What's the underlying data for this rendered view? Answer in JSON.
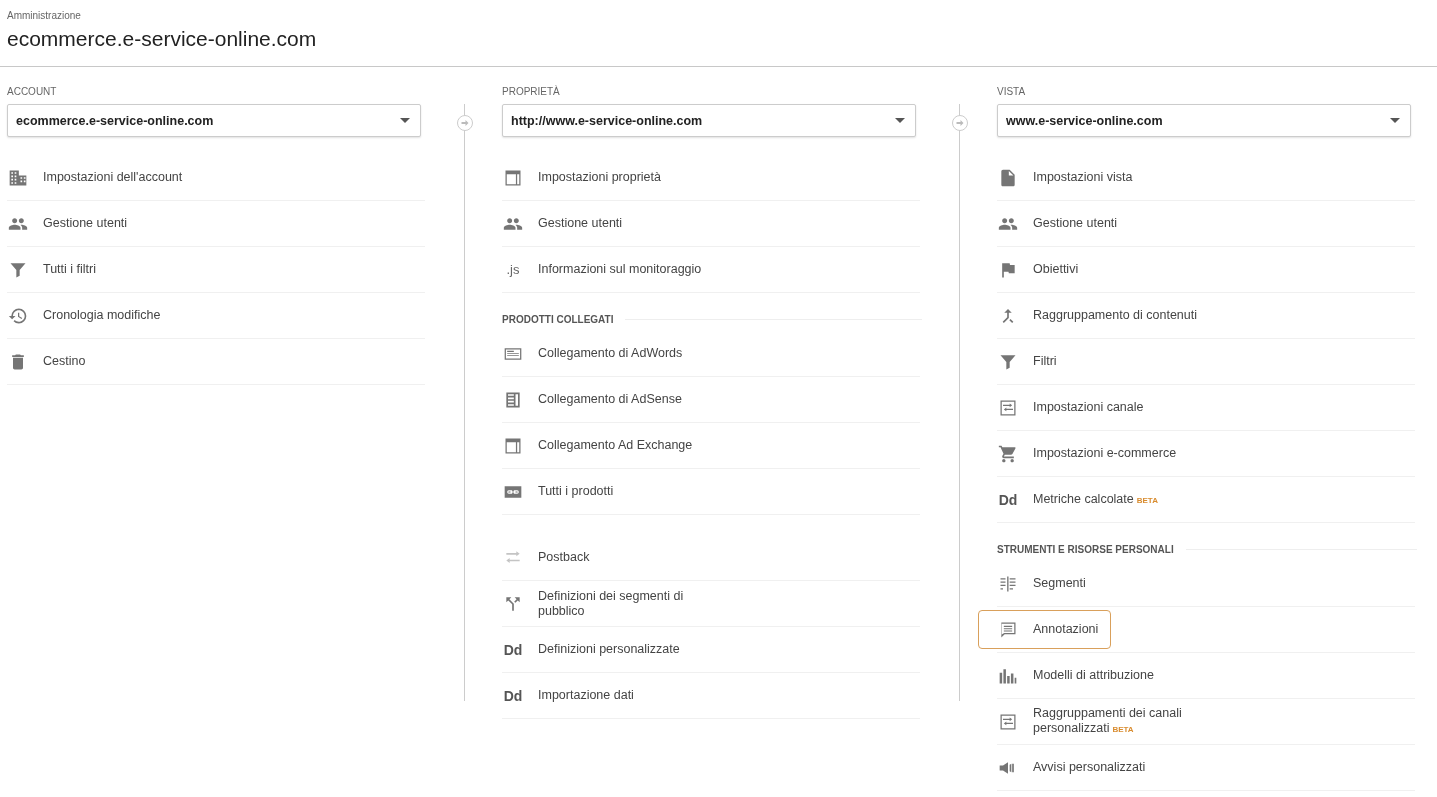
{
  "header": {
    "breadcrumb": "Amministrazione",
    "title": "ecommerce.e-service-online.com"
  },
  "columns": [
    {
      "label": "ACCOUNT",
      "dropdown": {
        "value": "ecommerce.e-service-online.com"
      },
      "sections": [
        {
          "items": [
            {
              "kind": "building",
              "label": "Impostazioni dell'account",
              "selected": false
            },
            {
              "kind": "people",
              "label": "Gestione utenti",
              "selected": false
            },
            {
              "kind": "filter",
              "label": "Tutti i filtri",
              "selected": false
            },
            {
              "kind": "history",
              "label": "Cronologia modifiche",
              "selected": false
            },
            {
              "kind": "trash",
              "label": "Cestino",
              "selected": false
            }
          ]
        }
      ]
    },
    {
      "label": "PROPRIETÀ",
      "dropdown": {
        "value": "http://www.e-service-online.com"
      },
      "sections": [
        {
          "items": [
            {
              "kind": "window",
              "label": "Impostazioni proprietà",
              "selected": false
            },
            {
              "kind": "people",
              "label": "Gestione utenti",
              "selected": false
            },
            {
              "kind": "glyph",
              "icon_text": ".js",
              "label": "Informazioni sul monitoraggio",
              "selected": false
            }
          ]
        },
        {
          "heading": "PRODOTTI COLLEGATI",
          "items": [
            {
              "kind": "adwords",
              "label": "Collegamento di AdWords",
              "selected": false
            },
            {
              "kind": "adsense",
              "label": "Collegamento di AdSense",
              "selected": false
            },
            {
              "kind": "window",
              "label": "Collegamento Ad Exchange",
              "selected": false
            },
            {
              "kind": "link",
              "label": "Tutti i prodotti",
              "selected": false
            }
          ]
        },
        {
          "items": [
            {
              "kind": "postback",
              "label": "Postback",
              "selected": false
            },
            {
              "kind": "fork",
              "label": "Definizioni dei segmenti di pubblico",
              "selected": false
            },
            {
              "kind": "glyph",
              "icon_text": "Dd",
              "label": "Definizioni personalizzate",
              "selected": false
            },
            {
              "kind": "glyph",
              "icon_text": "Dd",
              "label": "Importazione dati",
              "selected": false
            }
          ]
        }
      ]
    },
    {
      "label": "VISTA",
      "dropdown": {
        "value": "www.e-service-online.com"
      },
      "sections": [
        {
          "items": [
            {
              "kind": "doc",
              "label": "Impostazioni vista",
              "selected": false
            },
            {
              "kind": "people",
              "label": "Gestione utenti",
              "selected": false
            },
            {
              "kind": "flag",
              "label": "Obiettivi",
              "selected": false
            },
            {
              "kind": "merge",
              "label": "Raggruppamento di contenuti",
              "selected": false
            },
            {
              "kind": "filter",
              "label": "Filtri",
              "selected": false
            },
            {
              "kind": "channel",
              "label": "Impostazioni canale",
              "selected": false
            },
            {
              "kind": "cart",
              "label": "Impostazioni e-commerce",
              "selected": false
            },
            {
              "kind": "glyph",
              "icon_text": "Dd",
              "label": "Metriche calcolate",
              "badge": "BETA",
              "selected": false
            }
          ]
        },
        {
          "heading": "STRUMENTI E RISORSE PERSONALI",
          "items": [
            {
              "kind": "segments",
              "label": "Segmenti",
              "selected": false
            },
            {
              "kind": "comment",
              "label": "Annotazioni",
              "selected": true
            },
            {
              "kind": "bars",
              "label": "Modelli di attribuzione",
              "selected": false
            },
            {
              "kind": "channel",
              "label": "Raggruppamenti dei canali personalizzati",
              "badge": "BETA",
              "selected": false
            },
            {
              "kind": "megaphone",
              "label": "Avvisi personalizzati",
              "selected": false
            }
          ]
        }
      ]
    }
  ]
}
